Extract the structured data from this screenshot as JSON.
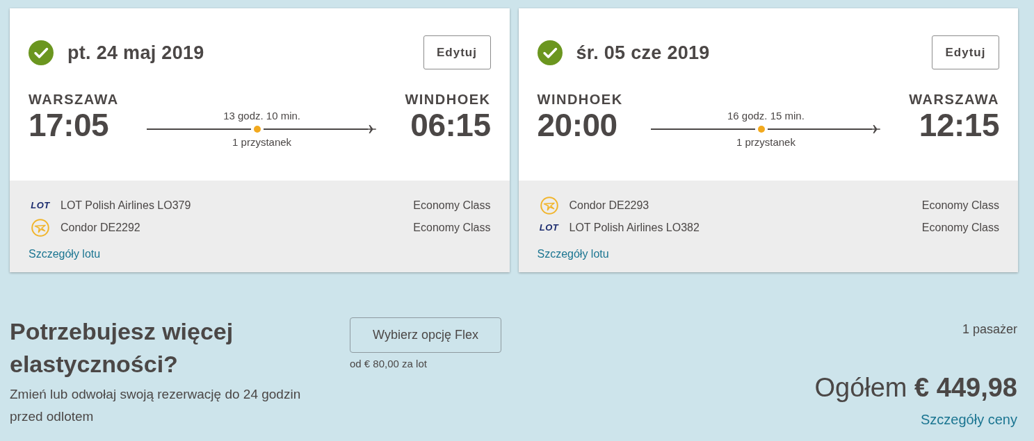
{
  "flights": [
    {
      "confirmed": true,
      "date": "pt. 24 maj 2019",
      "edit_label": "Edytuj",
      "origin": {
        "city": "WARSZAWA",
        "time": "17:05"
      },
      "destination": {
        "city": "WINDHOEK",
        "time": "06:15"
      },
      "duration": "13 godz. 10 min.",
      "stops": "1 przystanek",
      "legs": [
        {
          "kind": "lot",
          "logo": "LOT",
          "flight": "LOT Polish Airlines LO379",
          "cabin": "Economy Class"
        },
        {
          "kind": "condor",
          "flight": "Condor DE2292",
          "cabin": "Economy Class"
        }
      ],
      "details_link": "Szczegóły lotu"
    },
    {
      "confirmed": true,
      "date": "śr. 05 cze 2019",
      "edit_label": "Edytuj",
      "origin": {
        "city": "WINDHOEK",
        "time": "20:00"
      },
      "destination": {
        "city": "WARSZAWA",
        "time": "12:15"
      },
      "duration": "16 godz. 15 min.",
      "stops": "1 przystanek",
      "legs": [
        {
          "kind": "condor",
          "flight": "Condor DE2293",
          "cabin": "Economy Class"
        },
        {
          "kind": "lot",
          "logo": "LOT",
          "flight": "LOT Polish Airlines LO382",
          "cabin": "Economy Class"
        }
      ],
      "details_link": "Szczegóły lotu"
    }
  ],
  "flex": {
    "title": "Potrzebujesz więcej elastyczności?",
    "description": "Zmień lub odwołaj swoją rezerwację do 24 godzin przed odlotem",
    "button": "Wybierz opcję Flex",
    "price_note": "od € 80,00 za lot"
  },
  "summary": {
    "passengers": "1 pasażer",
    "total": "Ogółem **€ 449,98**",
    "details_link": "Szczegóły ceny"
  }
}
